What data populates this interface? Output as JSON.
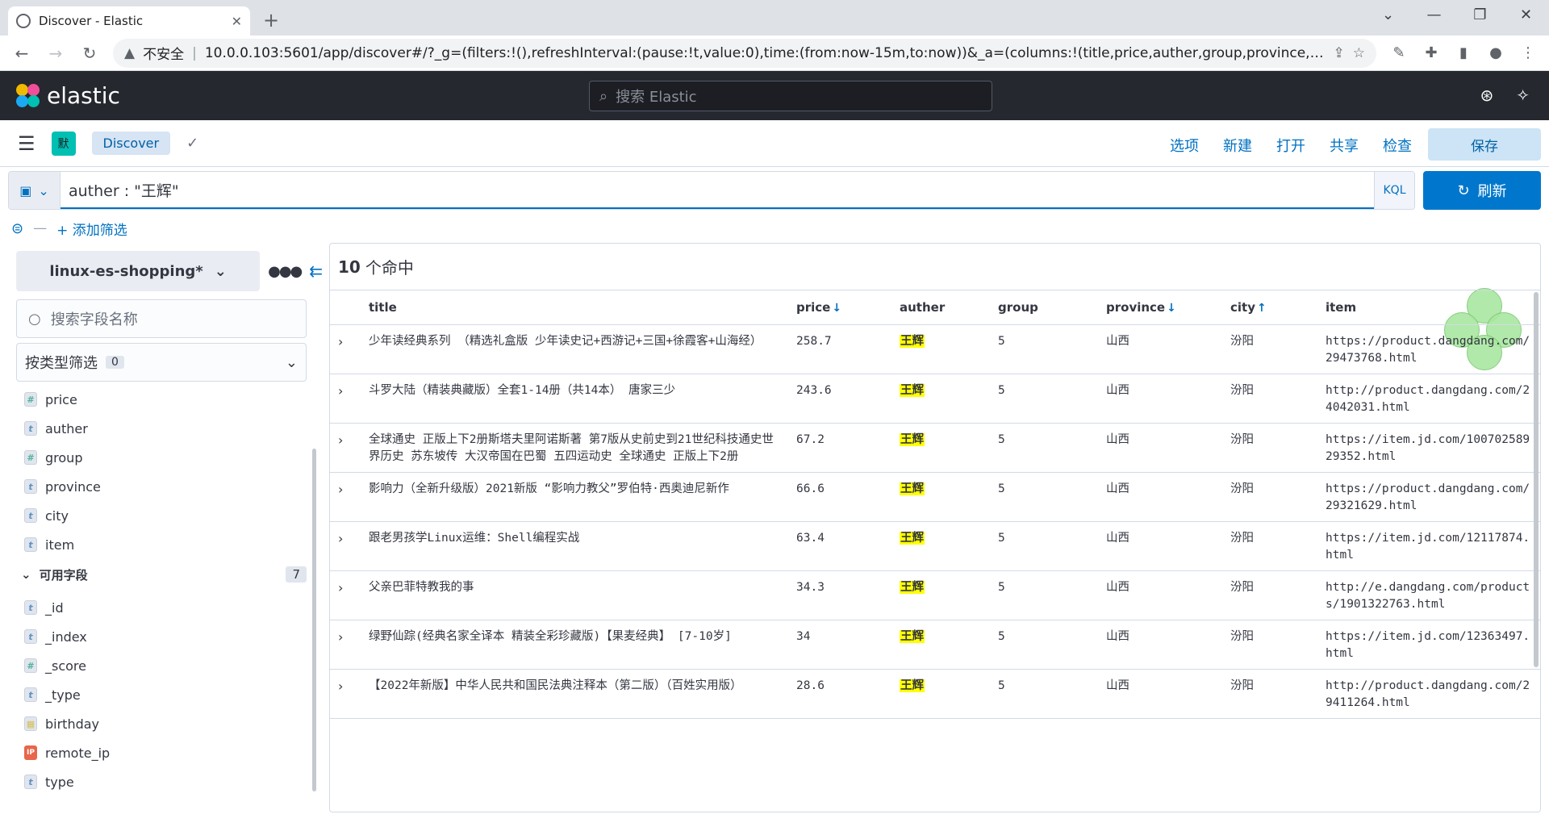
{
  "browser": {
    "tab_title": "Discover - Elastic",
    "security_label": "不安全",
    "url": "10.0.0.103:5601/app/discover#/?_g=(filters:!(),refreshInterval:(pause:!t,value:0),time:(from:now-15m,to:now))&_a=(columns:!(title,price,auther,group,province,city,it..."
  },
  "header": {
    "logo_text": "elastic",
    "search_placeholder": "搜索 Elastic"
  },
  "subheader": {
    "space_initial": "默",
    "breadcrumb": "Discover",
    "menu": [
      "选项",
      "新建",
      "打开",
      "共享",
      "检查"
    ],
    "save_label": "保存"
  },
  "query": {
    "text": "auther : \"王辉\"",
    "language": "KQL",
    "refresh_label": "刷新",
    "add_filter": "+ 添加筛选"
  },
  "sidebar": {
    "index_pattern": "linux-es-shopping*",
    "search_placeholder": "搜索字段名称",
    "type_filter_label": "按类型筛选",
    "type_filter_count": "0",
    "selected_fields": [
      {
        "type": "#",
        "name": "price"
      },
      {
        "type": "t",
        "name": "auther"
      },
      {
        "type": "#",
        "name": "group"
      },
      {
        "type": "t",
        "name": "province"
      },
      {
        "type": "t",
        "name": "city"
      },
      {
        "type": "t",
        "name": "item"
      }
    ],
    "available_label": "可用字段",
    "available_count": "7",
    "available_fields": [
      {
        "type": "t",
        "name": "_id"
      },
      {
        "type": "t",
        "name": "_index"
      },
      {
        "type": "#",
        "name": "_score"
      },
      {
        "type": "t",
        "name": "_type"
      },
      {
        "type": "d",
        "name": "birthday"
      },
      {
        "type": "ip",
        "name": "remote_ip"
      },
      {
        "type": "t",
        "name": "type"
      }
    ]
  },
  "results": {
    "hit_count": "10",
    "hit_suffix": "个命中",
    "columns": [
      {
        "label": "title",
        "sort": ""
      },
      {
        "label": "price",
        "sort": "↓"
      },
      {
        "label": "auther",
        "sort": ""
      },
      {
        "label": "group",
        "sort": ""
      },
      {
        "label": "province",
        "sort": "↓"
      },
      {
        "label": "city",
        "sort": "↑"
      },
      {
        "label": "item",
        "sort": ""
      }
    ],
    "rows": [
      {
        "title": "少年读经典系列 （精选礼盒版 少年读史记+西游记+三国+徐霞客+山海经）",
        "price": "258.7",
        "auther": "王辉",
        "group": "5",
        "province": "山西",
        "city": "汾阳",
        "item": "https://product.dangdang.com/29473768.html"
      },
      {
        "title": "斗罗大陆（精装典藏版）全套1-14册（共14本） 唐家三少",
        "price": "243.6",
        "auther": "王辉",
        "group": "5",
        "province": "山西",
        "city": "汾阳",
        "item": "http://product.dangdang.com/24042031.html"
      },
      {
        "title": "全球通史 正版上下2册斯塔夫里阿诺斯著 第7版从史前史到21世纪科技通史世界历史 苏东坡传 大汉帝国在巴蜀 五四运动史 全球通史 正版上下2册",
        "price": "67.2",
        "auther": "王辉",
        "group": "5",
        "province": "山西",
        "city": "汾阳",
        "item": "https://item.jd.com/10070258929352.html"
      },
      {
        "title": "影响力（全新升级版）2021新版 “影响力教父”罗伯特·西奥迪尼新作",
        "price": "66.6",
        "auther": "王辉",
        "group": "5",
        "province": "山西",
        "city": "汾阳",
        "item": "https://product.dangdang.com/29321629.html"
      },
      {
        "title": "跟老男孩学Linux运维：Shell编程实战",
        "price": "63.4",
        "auther": "王辉",
        "group": "5",
        "province": "山西",
        "city": "汾阳",
        "item": "https://item.jd.com/12117874.html"
      },
      {
        "title": "父亲巴菲特教我的事",
        "price": "34.3",
        "auther": "王辉",
        "group": "5",
        "province": "山西",
        "city": "汾阳",
        "item": "http://e.dangdang.com/products/1901322763.html"
      },
      {
        "title": "绿野仙踪(经典名家全译本 精装全彩珍藏版)【果麦经典】 [7-10岁]",
        "price": "34",
        "auther": "王辉",
        "group": "5",
        "province": "山西",
        "city": "汾阳",
        "item": "https://item.jd.com/12363497.html"
      },
      {
        "title": "【2022年新版】中华人民共和国民法典注释本（第二版）（百姓实用版）",
        "price": "28.6",
        "auther": "王辉",
        "group": "5",
        "province": "山西",
        "city": "汾阳",
        "item": "http://product.dangdang.com/29411264.html"
      }
    ]
  }
}
